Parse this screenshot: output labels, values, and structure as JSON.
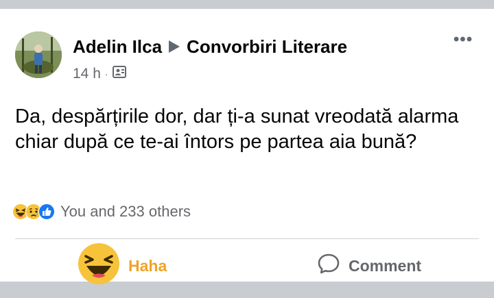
{
  "post": {
    "author": "Adelin Ilca",
    "group": "Convorbiri Literare",
    "time": "14 h",
    "separator": "·",
    "audience_icon": "group-audience-icon",
    "more_label": "•••",
    "text": "Da, despărțirile dor, dar ți-a sunat vreodată alarma chiar după ce te-ai întors pe partea aia bună?",
    "reactions": {
      "icons": [
        "haha-icon",
        "sad-icon",
        "like-icon"
      ],
      "summary": "You and 233 others"
    },
    "actions": {
      "reaction_label": "Haha",
      "comment_label": "Comment"
    }
  },
  "colors": {
    "haha": "#f0a228",
    "like": "#1877f2",
    "text": "#050505",
    "secondary": "#65676b",
    "background": "#c9ccd1"
  }
}
